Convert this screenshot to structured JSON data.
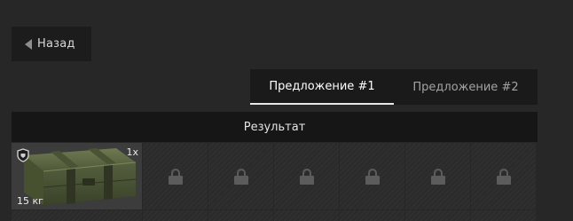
{
  "back_button": {
    "label": "Назад"
  },
  "tabs": [
    {
      "label": "Предложение #1",
      "active": true
    },
    {
      "label": "Предложение #2",
      "active": false
    }
  ],
  "result": {
    "title": "Результат",
    "item": {
      "icon": "military-crate",
      "badge_icon": "shield-icon",
      "count": "1x",
      "weight": "15 кг"
    },
    "locked_slots_row1": 6,
    "slot_icon": "lock-icon"
  },
  "colors": {
    "background": "#272727",
    "panel": "#1a1a1a",
    "active_tab_underline": "#e8e8e8",
    "slot": "#2b2b2b",
    "lock": "#5c5c5c"
  }
}
